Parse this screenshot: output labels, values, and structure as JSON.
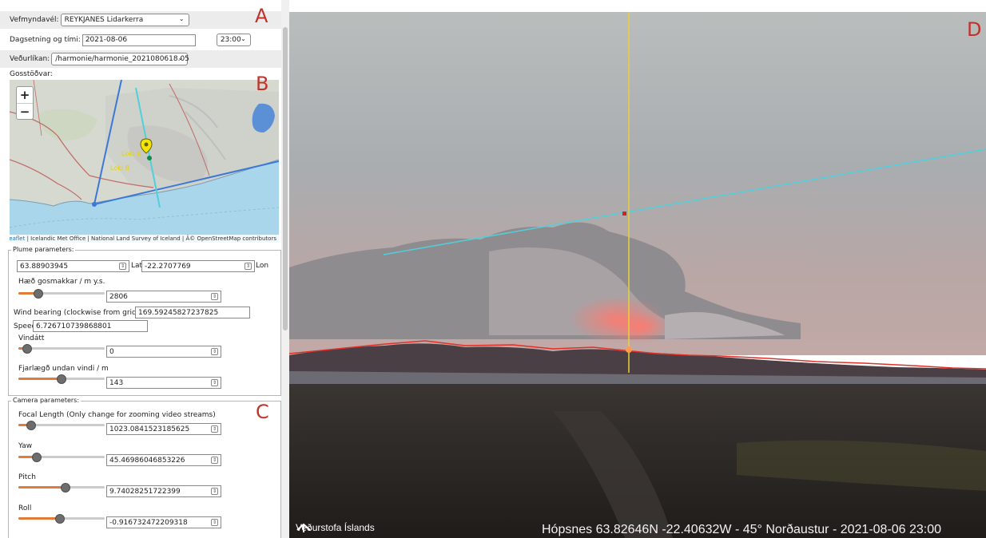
{
  "header": {
    "vefmyndavel_label": "Vefmyndavél:",
    "vefmyndavel_value": "REYKJANES Lidarkerra",
    "date_label": "Dagsetning og tími:",
    "date_value": "2021-08-06",
    "time_value": "23:00",
    "model_label": "Veðurlíkan:",
    "model_value": "/harmonie/harmonie_2021080618.05",
    "vents_label": "Gosstöðvar:"
  },
  "annotations": {
    "a": "A",
    "b": "B",
    "c": "C",
    "d": "D"
  },
  "map": {
    "zoom_in": "+",
    "zoom_out": "−",
    "attribution_leaflet": "Leaflet",
    "attribution_rest": " | Icelandic Met Office | National Land Survey of Iceland | Â© OpenStreetMap contributors",
    "marker_label_1": "Loki B",
    "marker_label_2": "Loki B"
  },
  "plume": {
    "legend": "Plume parameters:",
    "lat_value": "63.88903945",
    "lat_label": "Lat",
    "lon_value": "-22.2707769",
    "lon_label": "Lon",
    "height_label": "Hæð gosmakkar / m y.s.",
    "height_value": "2806",
    "height_fraction": 0.2,
    "wind_bearing_label": "Wind bearing (clockwise from grid north)",
    "wind_bearing_value": "169.59245827237825",
    "speed_label": "Speed",
    "speed_value": "6.726710739868801",
    "vindatt_label": "Vindátt",
    "vindatt_value": "0",
    "vindatt_fraction": 0.05,
    "distance_label": "Fjarlægð undan vindi / m",
    "distance_value": "143",
    "distance_fraction": 0.5
  },
  "camera": {
    "legend": "Camera parameters:",
    "focal_label": "Focal Length (Only change for zooming video streams)",
    "focal_value": "1023.0841523185625",
    "focal_fraction": 0.1,
    "yaw_label": "Yaw",
    "yaw_value": "45.46986046853226",
    "yaw_fraction": 0.18,
    "pitch_label": "Pitch",
    "pitch_value": "9.74028251722399",
    "pitch_fraction": 0.55,
    "roll_label": "Roll",
    "roll_value": "-0.916732472209318",
    "roll_fraction": 0.48
  },
  "view": {
    "logo_text": "Veðurstofa Íslands",
    "caption": "Hópsnes 63.82646N -22.40632W - 45° Norðaustur - 2021-08-06 23:00"
  },
  "icons": {
    "dropdown": "chevron-down-icon",
    "spinner": "spinner-icon",
    "logo": "vedurstofa-logo-icon",
    "marker": "map-marker-icon"
  },
  "colors": {
    "slider_fill": "#e07b3a",
    "annotation_letter": "#c0322b",
    "plume_line": "#4fd0dc",
    "vertical_line": "#e8d23a",
    "horizon_line": "#e0302a",
    "map_sea": "#a9d6ea"
  }
}
